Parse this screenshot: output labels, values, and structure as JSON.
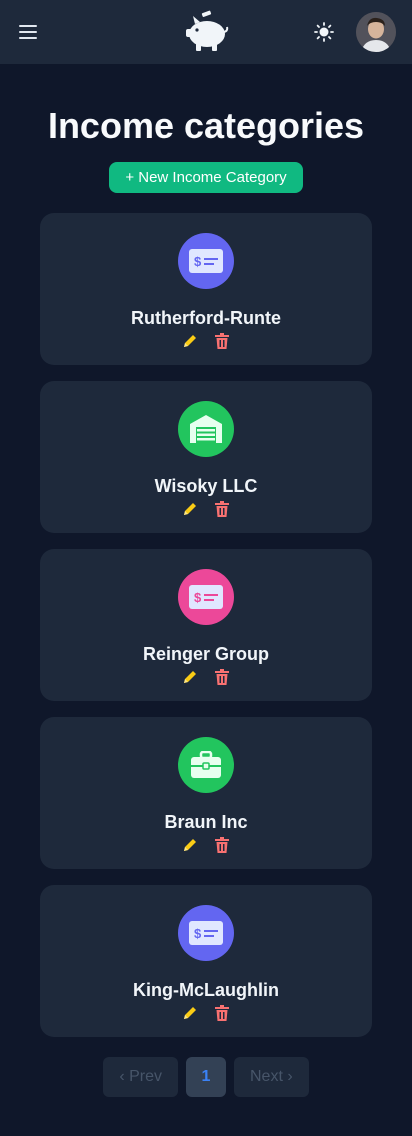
{
  "header": {
    "menu_icon": "hamburger-menu-icon",
    "logo_icon": "piggy-bank-icon",
    "theme_icon": "sun-icon",
    "avatar": "user-avatar"
  },
  "page": {
    "title": "Income categories",
    "new_button_label": "+ New Income Category"
  },
  "categories": [
    {
      "name": "Rutherford-Runte",
      "icon": "check-icon",
      "color": "#6366f1"
    },
    {
      "name": "Wisoky LLC",
      "icon": "warehouse-icon",
      "color": "#22c55e"
    },
    {
      "name": "Reinger Group",
      "icon": "check-icon",
      "color": "#ec4899"
    },
    {
      "name": "Braun Inc",
      "icon": "briefcase-icon",
      "color": "#22c55e"
    },
    {
      "name": "King-McLaughlin",
      "icon": "check-icon",
      "color": "#6366f1"
    }
  ],
  "actions": {
    "edit_icon": "pencil-icon",
    "delete_icon": "trash-icon",
    "edit_color": "#facc15",
    "delete_color": "#f87171"
  },
  "pagination": {
    "prev_label": "‹ Prev",
    "current_page": "1",
    "next_label": "Next ›"
  },
  "colors": {
    "background": "#0f172a",
    "surface": "#1e293b",
    "accent": "#10b981"
  }
}
